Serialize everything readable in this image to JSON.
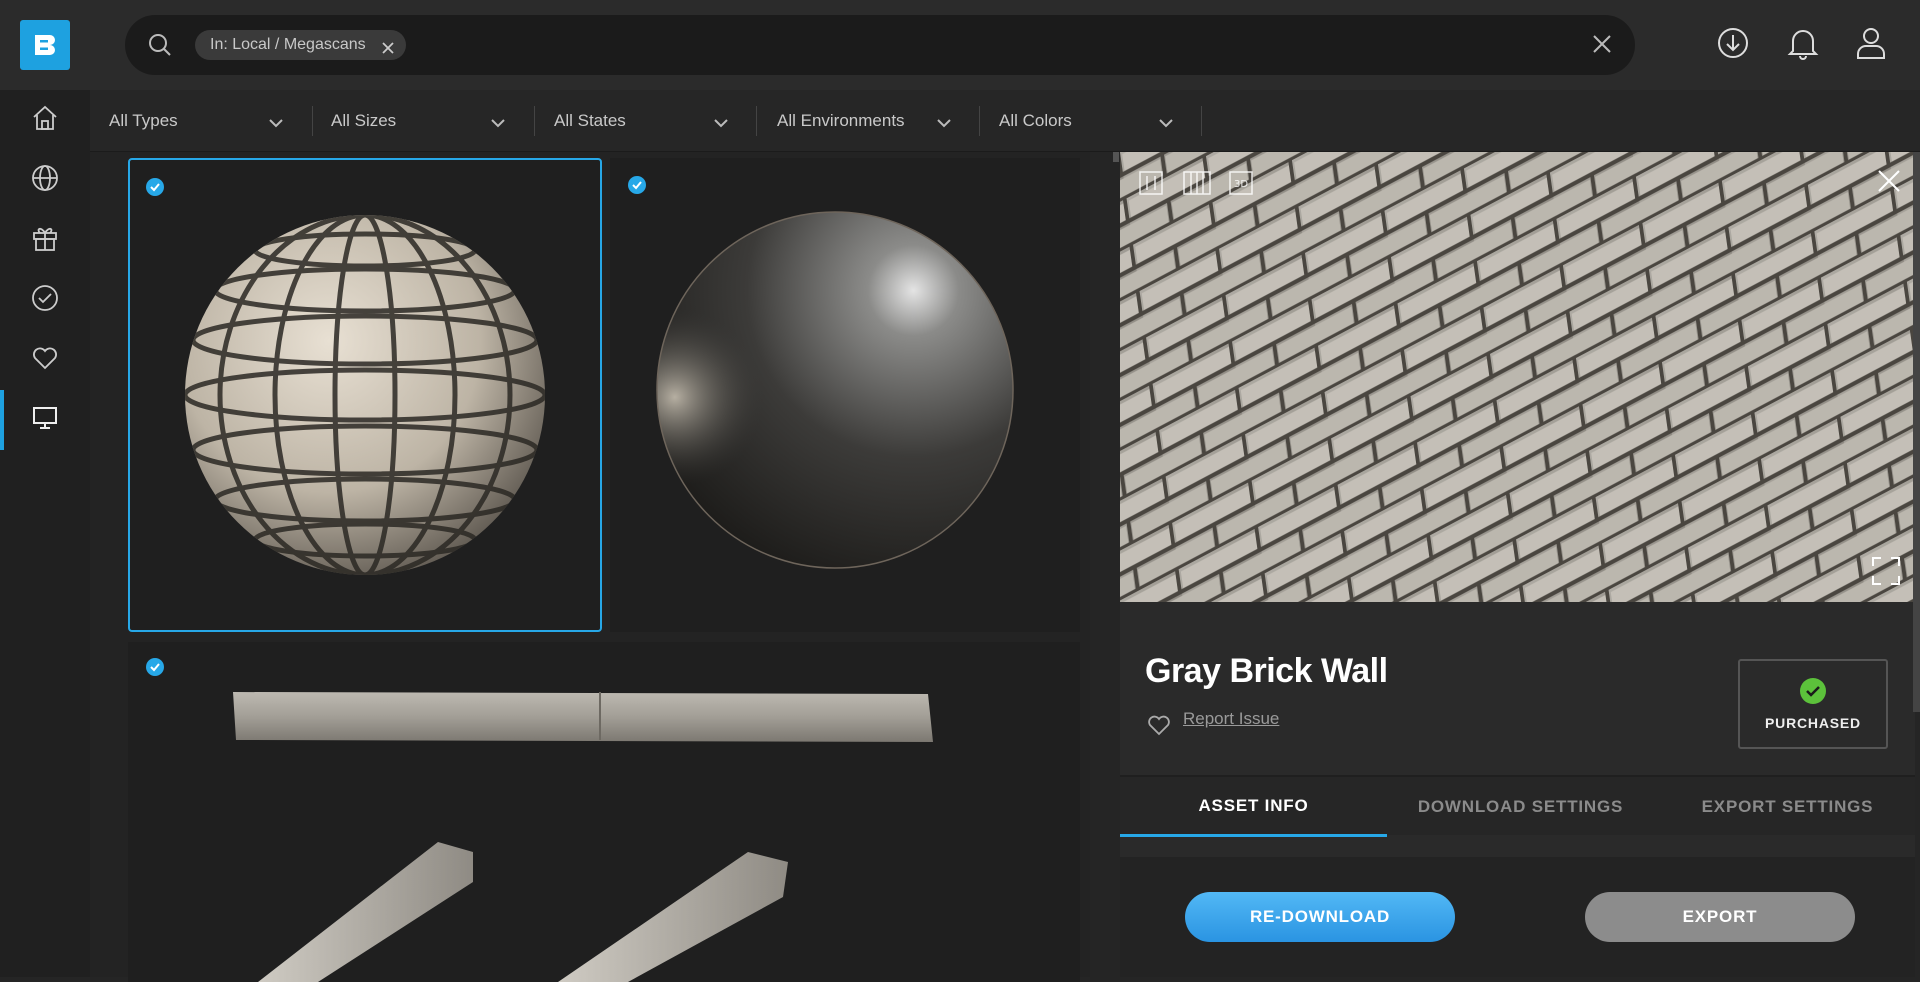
{
  "search": {
    "chip_label": "In: Local / Megascans",
    "placeholder": ""
  },
  "filters": [
    {
      "label": "All Types"
    },
    {
      "label": "All Sizes"
    },
    {
      "label": "All States"
    },
    {
      "label": "All Environments"
    },
    {
      "label": "All Colors"
    }
  ],
  "sidebar": {
    "items": [
      {
        "icon": "home-icon"
      },
      {
        "icon": "globe-icon"
      },
      {
        "icon": "gift-icon"
      },
      {
        "icon": "check-circle-icon"
      },
      {
        "icon": "heart-icon"
      },
      {
        "icon": "monitor-icon",
        "active": true
      }
    ]
  },
  "detail": {
    "title": "Gray Brick Wall",
    "report_label": "Report Issue",
    "purchased_label": "PURCHASED",
    "tabs": [
      {
        "label": "ASSET INFO",
        "active": true
      },
      {
        "label": "DOWNLOAD SETTINGS"
      },
      {
        "label": "EXPORT SETTINGS"
      }
    ],
    "redownload_label": "RE-DOWNLOAD",
    "export_label": "EXPORT",
    "preview_page": 1,
    "preview_pages": 3
  },
  "colors": {
    "accent": "#27a8e8",
    "purchased_green": "#5cc13b"
  }
}
